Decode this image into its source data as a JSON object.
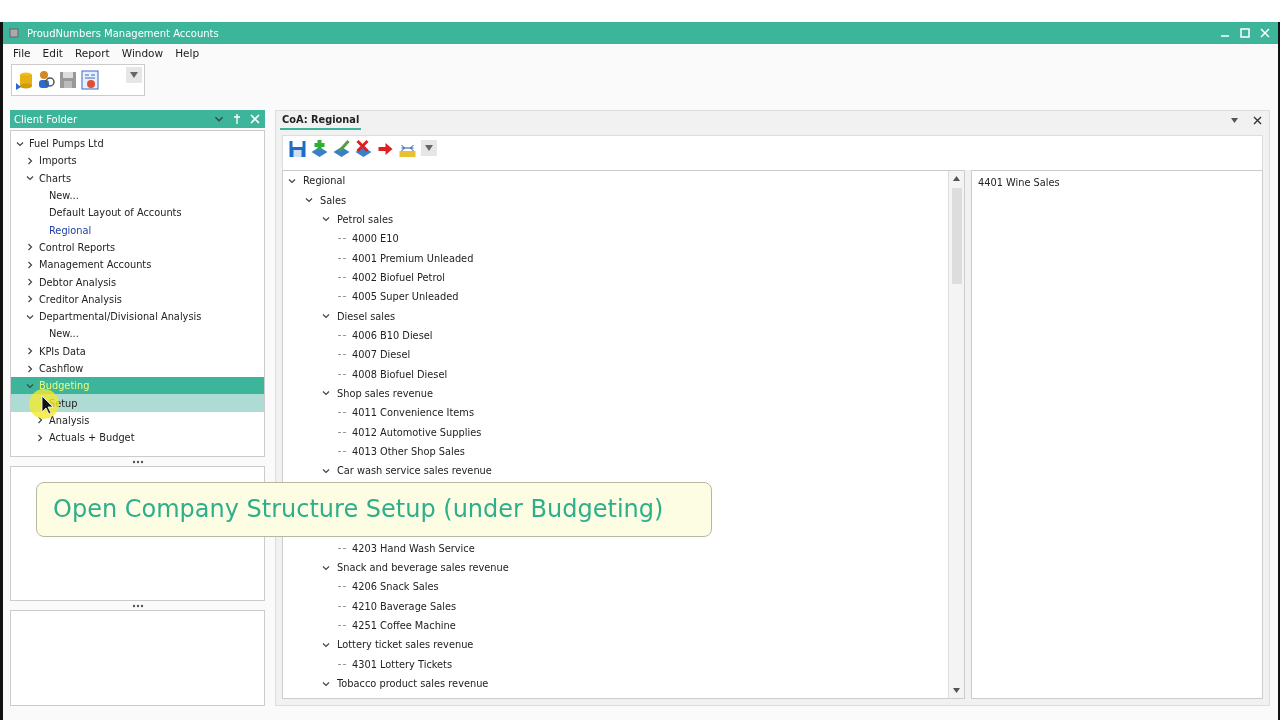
{
  "window": {
    "title": "ProudNumbers Management Accounts"
  },
  "menu": [
    "File",
    "Edit",
    "Report",
    "Window",
    "Help"
  ],
  "client_folder": {
    "title": "Client Folder",
    "tree": [
      {
        "label": "Fuel Pumps Ltd",
        "expanded": true,
        "selected": false,
        "children": [
          {
            "label": "Imports",
            "expanded": false,
            "selected": false
          },
          {
            "label": "Charts",
            "expanded": true,
            "selected": false,
            "children": [
              {
                "label": "New...",
                "selected": false
              },
              {
                "label": "Default Layout of Accounts",
                "selected": false
              },
              {
                "label": "Regional",
                "selected": false,
                "current": true
              }
            ]
          },
          {
            "label": "Control Reports",
            "expanded": false,
            "selected": false
          },
          {
            "label": "Management Accounts",
            "expanded": false,
            "selected": false
          },
          {
            "label": "Debtor Analysis",
            "expanded": false,
            "selected": false
          },
          {
            "label": "Creditor Analysis",
            "expanded": false,
            "selected": false
          },
          {
            "label": "Departmental/Divisional Analysis",
            "expanded": true,
            "selected": false,
            "children": [
              {
                "label": "New...",
                "selected": false
              }
            ]
          },
          {
            "label": "KPIs Data",
            "expanded": false,
            "selected": false
          },
          {
            "label": "Cashflow",
            "expanded": false,
            "selected": false
          },
          {
            "label": "Budgeting",
            "expanded": true,
            "selected": true,
            "children": [
              {
                "label": "Setup",
                "selected": false,
                "hovered": true
              },
              {
                "label": "Analysis",
                "expanded": false,
                "selected": false
              },
              {
                "label": "Actuals + Budget",
                "expanded": false,
                "selected": false
              }
            ]
          }
        ]
      }
    ]
  },
  "document": {
    "tab": "CoA: Regional",
    "tree": [
      {
        "label": "Regional",
        "expanded": true,
        "children": [
          {
            "label": "Sales",
            "expanded": true,
            "children": [
              {
                "label": "Petrol sales",
                "expanded": true,
                "children": [
                  {
                    "label": "4000 E10"
                  },
                  {
                    "label": "4001 Premium Unleaded"
                  },
                  {
                    "label": "4002 Biofuel Petrol"
                  },
                  {
                    "label": "4005 Super Unleaded"
                  }
                ]
              },
              {
                "label": "Diesel sales",
                "expanded": true,
                "children": [
                  {
                    "label": "4006 B10 Diesel"
                  },
                  {
                    "label": "4007 Diesel"
                  },
                  {
                    "label": "4008 Biofuel Diesel"
                  }
                ]
              },
              {
                "label": "Shop sales revenue",
                "expanded": true,
                "children": [
                  {
                    "label": "4011 Convenience Items"
                  },
                  {
                    "label": "4012 Automotive Supplies"
                  },
                  {
                    "label": "4013 Other Shop Sales"
                  }
                ]
              },
              {
                "label": "Car wash service sales revenue",
                "expanded": true,
                "children": [
                  {
                    "kind": "caption",
                    "text": "Open Company Structure Setup (under Budgeting)"
                  },
                  {
                    "label": "4203 Hand Wash Service"
                  }
                ]
              },
              {
                "label": "Snack and beverage sales revenue",
                "expanded": true,
                "children": [
                  {
                    "label": "4206 Snack Sales"
                  },
                  {
                    "label": "4210 Baverage Sales"
                  },
                  {
                    "label": "4251 Coffee Machine"
                  }
                ]
              },
              {
                "label": "Lottery ticket sales revenue",
                "expanded": true,
                "children": [
                  {
                    "label": "4301 Lottery  Tickets"
                  }
                ]
              },
              {
                "label": "Tobacco product sales revenue",
                "expanded": true
              }
            ]
          }
        ]
      }
    ],
    "side_list": [
      "4401 Wine Sales"
    ]
  }
}
